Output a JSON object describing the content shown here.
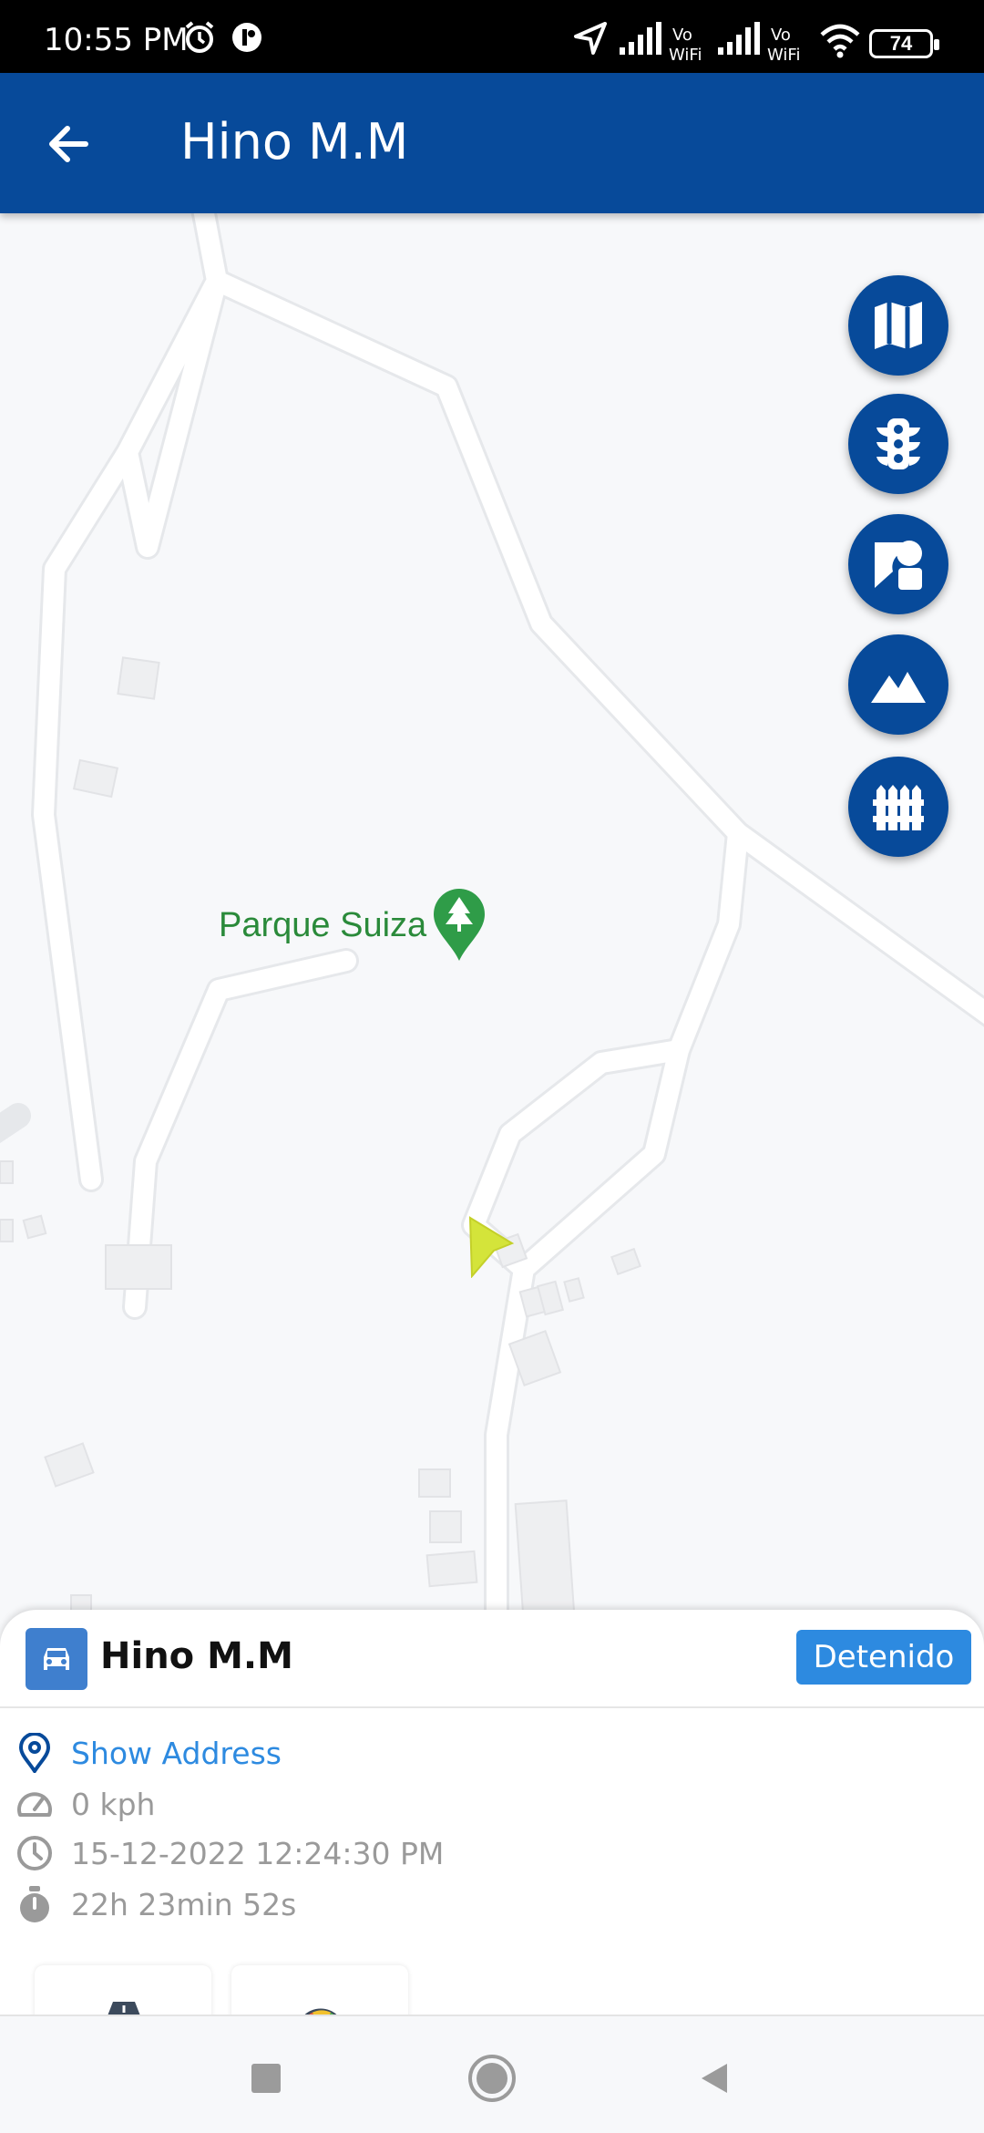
{
  "status_bar": {
    "time": "10:55 PM",
    "battery": "74",
    "icons": [
      "alarm-icon",
      "app-notification-icon",
      "location-icon",
      "signal-icon",
      "vowifi-icon",
      "signal-icon",
      "vowifi-icon",
      "wifi-icon",
      "battery-icon"
    ]
  },
  "app_bar": {
    "title": "Hino M.M",
    "back_icon": "arrow-back-icon",
    "color": "#074a9a"
  },
  "map": {
    "poi_label": "Parque Suiza",
    "poi_icon": "park-tree-icon",
    "vehicle_marker_color": "#d4e43a",
    "fab_buttons": [
      "map-type-icon",
      "traffic-light-icon",
      "shapes-icon",
      "terrain-icon",
      "fence-icon"
    ]
  },
  "vehicle_sheet": {
    "name": "Hino M.M",
    "status": "Detenido",
    "status_color": "#2d8ae0",
    "address_link": "Show Address",
    "speed": "0 kph",
    "timestamp": "15-12-2022 12:24:30 PM",
    "duration": "22h 23min 52s"
  },
  "nav_bar": {
    "buttons": [
      "recents-square-icon",
      "home-circle-icon",
      "back-triangle-icon"
    ]
  }
}
